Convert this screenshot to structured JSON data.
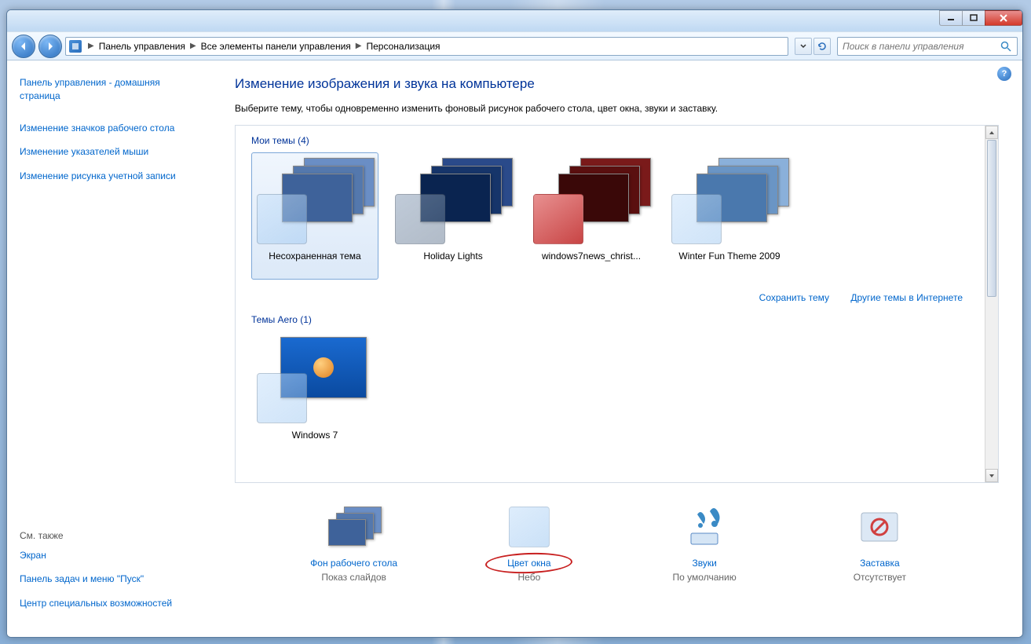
{
  "breadcrumb": {
    "b1": "Панель управления",
    "b2": "Все элементы панели управления",
    "b3": "Персонализация"
  },
  "search": {
    "placeholder": "Поиск в панели управления"
  },
  "sidebar": {
    "home": "Панель управления - домашняя страница",
    "links": [
      "Изменение значков рабочего стола",
      "Изменение указателей мыши",
      "Изменение рисунка учетной записи"
    ],
    "seealso": "См. также",
    "footer": [
      "Экран",
      "Панель задач и меню \"Пуск\"",
      "Центр специальных возможностей"
    ]
  },
  "main": {
    "title": "Изменение изображения и звука на компьютере",
    "desc": "Выберите тему, чтобы одновременно изменить фоновый рисунок рабочего стола, цвет окна, звуки и заставку.",
    "group1": "Мои темы (4)",
    "themes1": [
      {
        "name": "Несохраненная тема",
        "selected": true,
        "colors": [
          "#6a8ec5",
          "#5478ad",
          "#3e629a"
        ],
        "swatch": "glass"
      },
      {
        "name": "Holiday Lights",
        "colors": [
          "#2a4a8a",
          "#16356a",
          "#0a2450"
        ],
        "swatch": "glass-dk"
      },
      {
        "name": "windows7news_christ...",
        "colors": [
          "#7a1a1a",
          "#5a0f0f",
          "#3a0808"
        ],
        "swatch": "red"
      },
      {
        "name": "Winter Fun Theme 2009",
        "colors": [
          "#8ab0da",
          "#6a95c5",
          "#4a78ad"
        ],
        "swatch": "glass"
      }
    ],
    "save_link": "Сохранить тему",
    "online_link": "Другие темы в Интернете",
    "group2": "Темы Aero (1)",
    "themes2": [
      {
        "name": "Windows 7",
        "single": true,
        "color": "#1a6ad0",
        "swatch": "glass"
      }
    ],
    "bottom": [
      {
        "title": "Фон рабочего стола",
        "sub": "Показ слайдов",
        "kind": "wall"
      },
      {
        "title": "Цвет окна",
        "sub": "Небо",
        "kind": "color",
        "circled": true
      },
      {
        "title": "Звуки",
        "sub": "По умолчанию",
        "kind": "sound"
      },
      {
        "title": "Заставка",
        "sub": "Отсутствует",
        "kind": "saver"
      }
    ]
  }
}
